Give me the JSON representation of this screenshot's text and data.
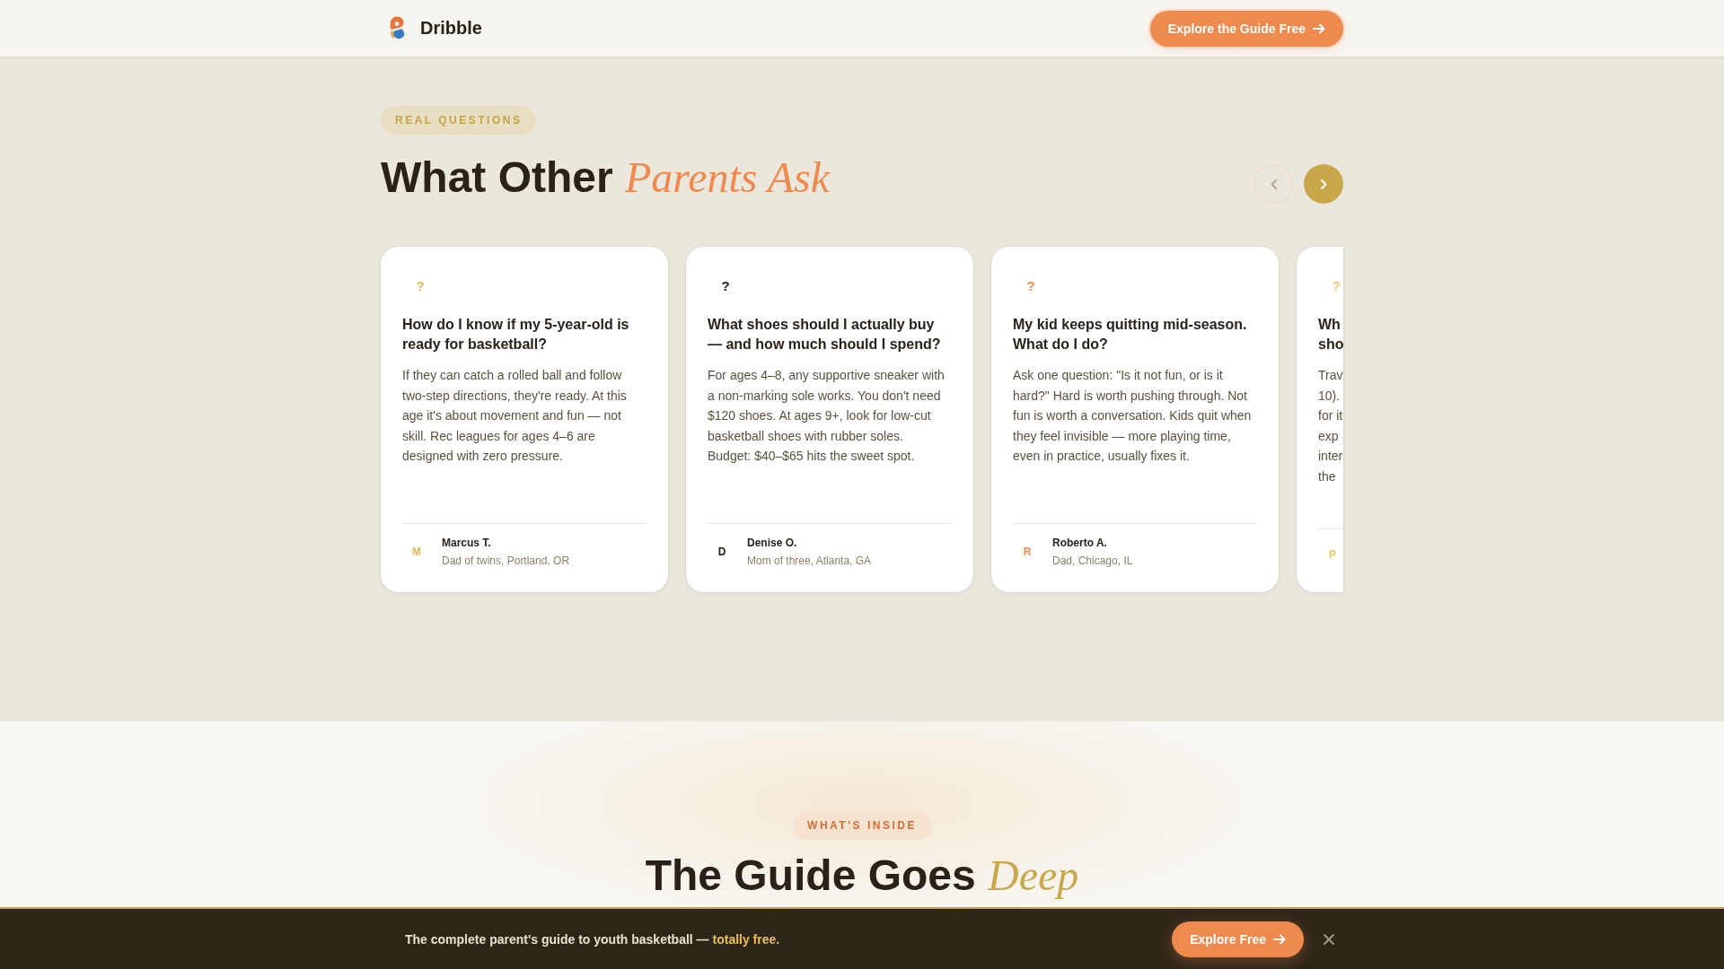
{
  "header": {
    "brand": "Dribble",
    "cta": "Explore the Guide Free"
  },
  "questions_section": {
    "badge": "REAL QUESTIONS",
    "title": "What Other *Parents Ask*",
    "nav": [
      {
        "kind": "prev",
        "disabled": true
      },
      {
        "kind": "next",
        "disabled": false
      }
    ],
    "cards": [
      {
        "kind": "full",
        "mark": "?",
        "color": "#e5bb57",
        "question": "How do I know if my 5-year-old is ready for basketball?",
        "answer": "If they can catch a rolled ball and follow two-step directions, they're ready. At this age it's about movement and fun — not skill. Rec leagues for ages 4–6 are designed with zero pressure.",
        "initial": "M",
        "author": "Marcus T.",
        "role": "Dad of twins, Portland, OR"
      },
      {
        "kind": "full",
        "mark": "?",
        "color": "#1f1a14",
        "question": "What shoes should I actually buy — and how much should I spend?",
        "answer": "For ages 4–8, any supportive sneaker with a non-marking sole works. You don't need $120 shoes. At ages 9+, look for low-cut basketball shoes with rubber soles. Budget: $40–$65 hits the sweet spot.",
        "initial": "D",
        "author": "Denise O.",
        "role": "Mom of three, Atlanta, GA"
      },
      {
        "kind": "full",
        "mark": "?",
        "color": "#ee8a4e",
        "question": "My kid keeps quitting mid-season. What do I do?",
        "answer": "Ask one question: \"Is it not fun, or is it hard?\" Hard is worth pushing through. Not fun is worth a conversation. Kids quit when they feel invisible — more playing time, even in practice, usually fixes it.",
        "initial": "R",
        "author": "Roberto A.",
        "role": "Dad, Chicago, IL"
      },
      {
        "kind": "peek",
        "mark": "?",
        "color": "#edc868",
        "question_lines": [
          "Wh",
          "sho"
        ],
        "answer_lines": [
          "Trav",
          "10).",
          "for it",
          "exp",
          "inter",
          "the"
        ],
        "initial": "P"
      }
    ]
  },
  "guide_section": {
    "badge": "WHAT'S INSIDE",
    "title": "The Guide Goes *Deep*"
  },
  "promo_bar": {
    "message": "The complete parent's guide to youth basketball —",
    "highlight": "totally free.",
    "cta": "Explore Free"
  }
}
